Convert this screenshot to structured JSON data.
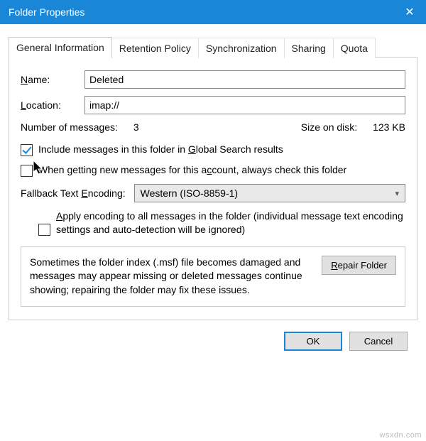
{
  "window": {
    "title": "Folder Properties",
    "close_glyph": "✕"
  },
  "tabs": {
    "general": "General Information",
    "retention": "Retention Policy",
    "sync": "Synchronization",
    "sharing": "Sharing",
    "quota": "Quota"
  },
  "fields": {
    "name_label": "Name:",
    "name_value": "Deleted",
    "location_label": "Location:",
    "location_value": "imap://"
  },
  "stats": {
    "messages_label": "Number of messages:",
    "messages_value": "3",
    "size_label": "Size on disk:",
    "size_value": "123 KB"
  },
  "checks": {
    "global_search": "Include messages in this folder in Global Search results",
    "always_check": "When getting new messages for this account, always check this folder"
  },
  "encoding": {
    "label": "Fallback Text Encoding:",
    "value": "Western (ISO-8859-1)",
    "apply_text": "Apply encoding to all messages in the folder (individual message text encoding settings and auto-detection will be ignored)"
  },
  "repair": {
    "text": "Sometimes the folder index (.msf) file becomes damaged and messages may appear missing or deleted messages continue showing; repairing the folder may fix these issues.",
    "button": "Repair Folder"
  },
  "buttons": {
    "ok": "OK",
    "cancel": "Cancel"
  },
  "watermark": "wsxdn.com"
}
